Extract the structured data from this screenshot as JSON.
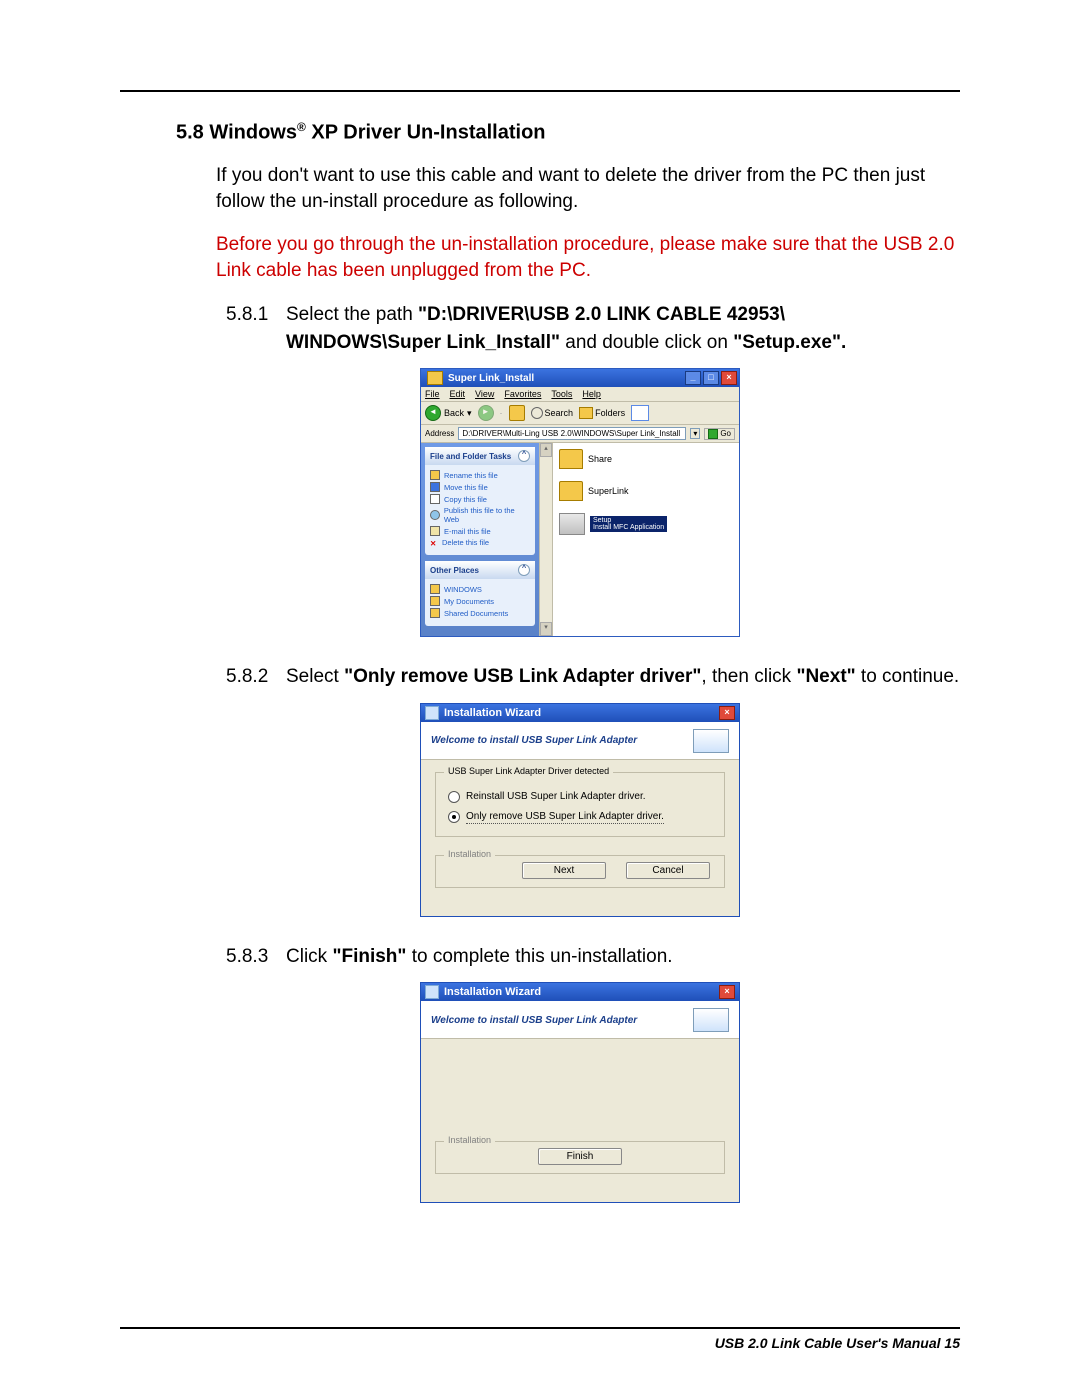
{
  "heading": {
    "num": "5.8",
    "title_before_reg": "Windows",
    "reg": "®",
    "title_after_reg": " XP Driver Un-Installation"
  },
  "para1": "If you don't want to use this cable and want to delete the driver from the PC then just follow the un-install procedure as following.",
  "para2": "Before you go through the un-installation procedure, please make sure that the USB 2.0 Link cable has been unplugged from the PC.",
  "step1": {
    "num": "5.8.1",
    "t1": "Select the path ",
    "bold1": "\"D:\\DRIVER\\USB 2.0 LINK CABLE 42953\\",
    "bold2": "WINDOWS\\Super Link_Install\"",
    "t2": " and double click on ",
    "bold3": "\"Setup.exe\"."
  },
  "explorer": {
    "title": "Super Link_Install",
    "menu": [
      "File",
      "Edit",
      "View",
      "Favorites",
      "Tools",
      "Help"
    ],
    "back": "Back",
    "search": "Search",
    "folders": "Folders",
    "addr_label": "Address",
    "address": "D:\\DRIVER\\Multi-Ling USB 2.0\\WINDOWS\\Super Link_Install",
    "go": "Go",
    "panel1_title": "File and Folder Tasks",
    "tasks": [
      "Rename this file",
      "Move this file",
      "Copy this file",
      "Publish this file to the Web",
      "E-mail this file",
      "Delete this file"
    ],
    "panel2_title": "Other Places",
    "places": [
      "WINDOWS",
      "My Documents",
      "Shared Documents"
    ],
    "items": {
      "share": "Share",
      "superlink": "SuperLink",
      "setup": "Setup",
      "setup_sub": "Install MFC Application"
    }
  },
  "step2": {
    "num": "5.8.2",
    "t1": "Select ",
    "bold1": "\"Only remove USB Link Adapter driver\"",
    "t2": ", then click ",
    "bold2": "\"Next\"",
    "t3": " to continue."
  },
  "dialog": {
    "title": "Installation   Wizard",
    "welcome": "Welcome to install USB Super Link Adapter",
    "group_label": "USB Super Link Adapter Driver detected",
    "opt1": "Reinstall USB Super Link Adapter driver.",
    "opt2": "Only remove USB Super Link Adapter driver.",
    "install_label": "Installation",
    "next": "Next",
    "cancel": "Cancel",
    "finish": "Finish"
  },
  "step3": {
    "num": "5.8.3",
    "t1": "Click ",
    "bold1": "\"Finish\"",
    "t2": " to complete this un-installation."
  },
  "footer": "USB 2.0 Link Cable User's Manual 15"
}
